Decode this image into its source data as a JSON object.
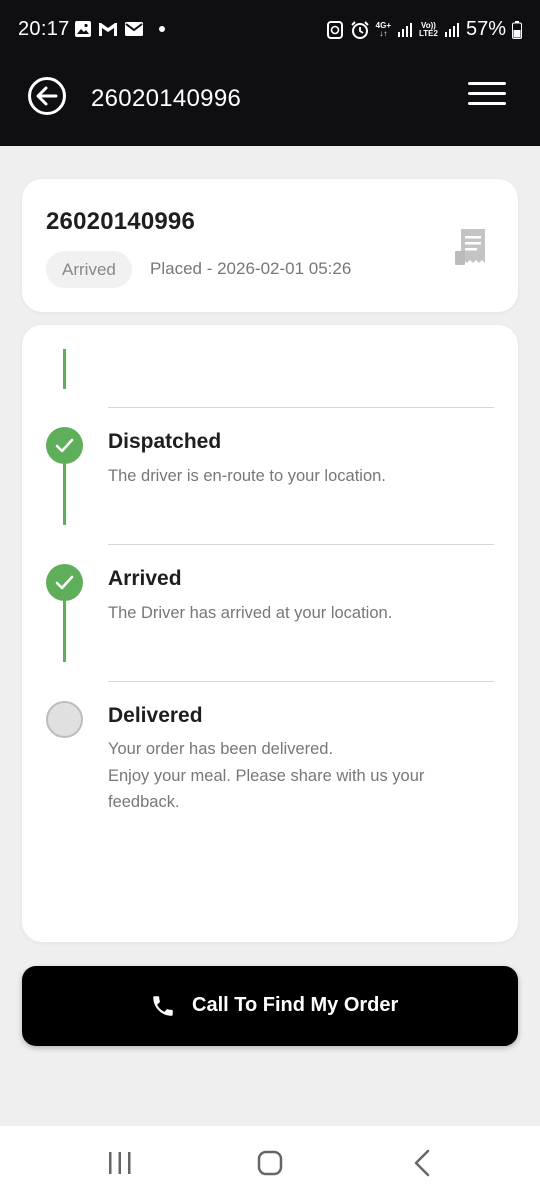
{
  "status_bar": {
    "time": "20:17",
    "battery": "57%",
    "network_top": "4G+",
    "volte_top": "Vo))",
    "volte_bottom": "LTE2",
    "left_icons": [
      "image-icon",
      "gmail-icon",
      "mail-icon",
      "dot-icon"
    ],
    "right_icons": [
      "sync-icon",
      "alarm-icon",
      "signal-icon",
      "battery-icon"
    ]
  },
  "app_bar": {
    "title": "26020140996",
    "back_icon": "back-arrow-icon",
    "menu_icon": "hamburger-menu-icon"
  },
  "order": {
    "id": "26020140996",
    "status": "Arrived",
    "placed": "Placed - 2026-02-01 05:26",
    "receipt_icon": "receipt-icon"
  },
  "timeline": {
    "steps": [
      {
        "title": "Dispatched",
        "description": "The driver is en-route to your location.",
        "state": "done"
      },
      {
        "title": "Arrived",
        "description": "The Driver has arrived at your location.",
        "state": "done"
      },
      {
        "title": "Delivered",
        "description": "Your order has been delivered.",
        "description_2": "Enjoy your meal. Please share with us your feedback.",
        "state": "pending"
      }
    ]
  },
  "call_button": {
    "label": "Call To Find My Order",
    "icon": "phone-icon"
  },
  "colors": {
    "header_bg": "#0f0e13",
    "accent_green": "#5fae5a",
    "page_bg": "#efefef",
    "button_bg": "#000000"
  },
  "nav_bar": {
    "icons": [
      "recent-apps-icon",
      "home-icon",
      "back-icon"
    ]
  }
}
